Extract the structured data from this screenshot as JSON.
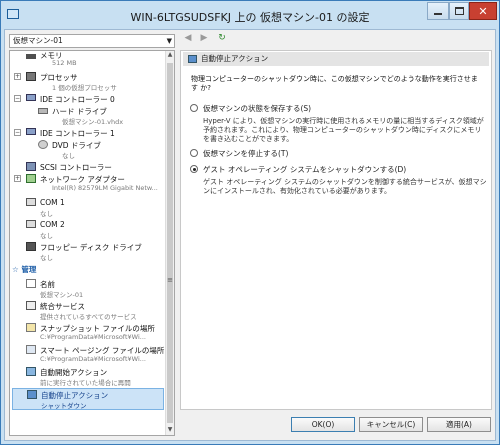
{
  "window": {
    "title": "WIN-6LTGSUDSFKJ 上の 仮想マシン-01 の設定"
  },
  "vm_selector": {
    "value": "仮想マシン-01"
  },
  "hardware": [
    {
      "name": "memory",
      "label": "メモリ",
      "detail": "512 MB",
      "icon": "memory-icon"
    },
    {
      "name": "processor",
      "label": "プロセッサ",
      "detail": "1 個の仮想プロセッサ",
      "icon": "processor-icon"
    },
    {
      "name": "ide0",
      "label": "IDE コントローラー 0",
      "detail": "",
      "icon": "ide-controller-icon"
    },
    {
      "name": "hdd",
      "label": "ハード ドライブ",
      "detail": "仮想マシン-01.vhdx",
      "icon": "hard-drive-icon"
    },
    {
      "name": "ide1",
      "label": "IDE コントローラー 1",
      "detail": "",
      "icon": "ide-controller-icon"
    },
    {
      "name": "dvd",
      "label": "DVD ドライブ",
      "detail": "なし",
      "icon": "dvd-drive-icon"
    },
    {
      "name": "scsi",
      "label": "SCSI コントローラー",
      "detail": "",
      "icon": "scsi-controller-icon"
    },
    {
      "name": "network",
      "label": "ネットワーク アダプター",
      "detail": "Intel(R) 82579LM Gigabit Netw...",
      "icon": "network-adapter-icon"
    },
    {
      "name": "com1",
      "label": "COM 1",
      "detail": "なし",
      "icon": "com-port-icon"
    },
    {
      "name": "com2",
      "label": "COM 2",
      "detail": "なし",
      "icon": "com-port-icon"
    },
    {
      "name": "floppy",
      "label": "フロッピー ディスク ドライブ",
      "detail": "なし",
      "icon": "floppy-drive-icon"
    }
  ],
  "management_header": "管理",
  "management": [
    {
      "name": "name",
      "label": "名前",
      "detail": "仮想マシン-01",
      "icon": "name-icon"
    },
    {
      "name": "integration",
      "label": "統合サービス",
      "detail": "提供されているすべてのサービス",
      "icon": "integration-services-icon"
    },
    {
      "name": "snapshot",
      "label": "スナップショット ファイルの場所",
      "detail": "C:¥ProgramData¥Microsoft¥Wi...",
      "icon": "snapshot-location-icon"
    },
    {
      "name": "paging",
      "label": "スマート ページング ファイルの場所",
      "detail": "C:¥ProgramData¥Microsoft¥Wi...",
      "icon": "smart-paging-icon"
    },
    {
      "name": "autostart",
      "label": "自動開始アクション",
      "detail": "前に実行されていた場合に再開",
      "icon": "auto-start-icon"
    },
    {
      "name": "autostop",
      "label": "自動停止アクション",
      "detail": "シャットダウン",
      "icon": "auto-stop-icon"
    }
  ],
  "panel": {
    "section_title": "自動停止アクション",
    "question": "物理コンピューターのシャットダウン時に、この仮想マシンでどのような動作を実行させます か?",
    "options": [
      {
        "label": "仮想マシンの状態を保存する(S)",
        "desc": "Hyper-V により、仮想マシンの実行時に使用されるメモリの量に相当するディスク領域が予約されます。これにより、物理コンピューターのシャットダウン時にディスクにメモリを書き込むことができます。",
        "selected": false
      },
      {
        "label": "仮想マシンを停止する(T)",
        "desc": "",
        "selected": false
      },
      {
        "label": "ゲスト オペレーティング システムをシャットダウンする(D)",
        "desc": "ゲスト オペレーティング システムのシャットダウンを制御する統合サービスが、仮想マシンにインストールされ、有効化されている必要があります。",
        "selected": true
      }
    ]
  },
  "buttons": {
    "ok": "OK(O)",
    "cancel": "キャンセル(C)",
    "apply": "適用(A)"
  }
}
